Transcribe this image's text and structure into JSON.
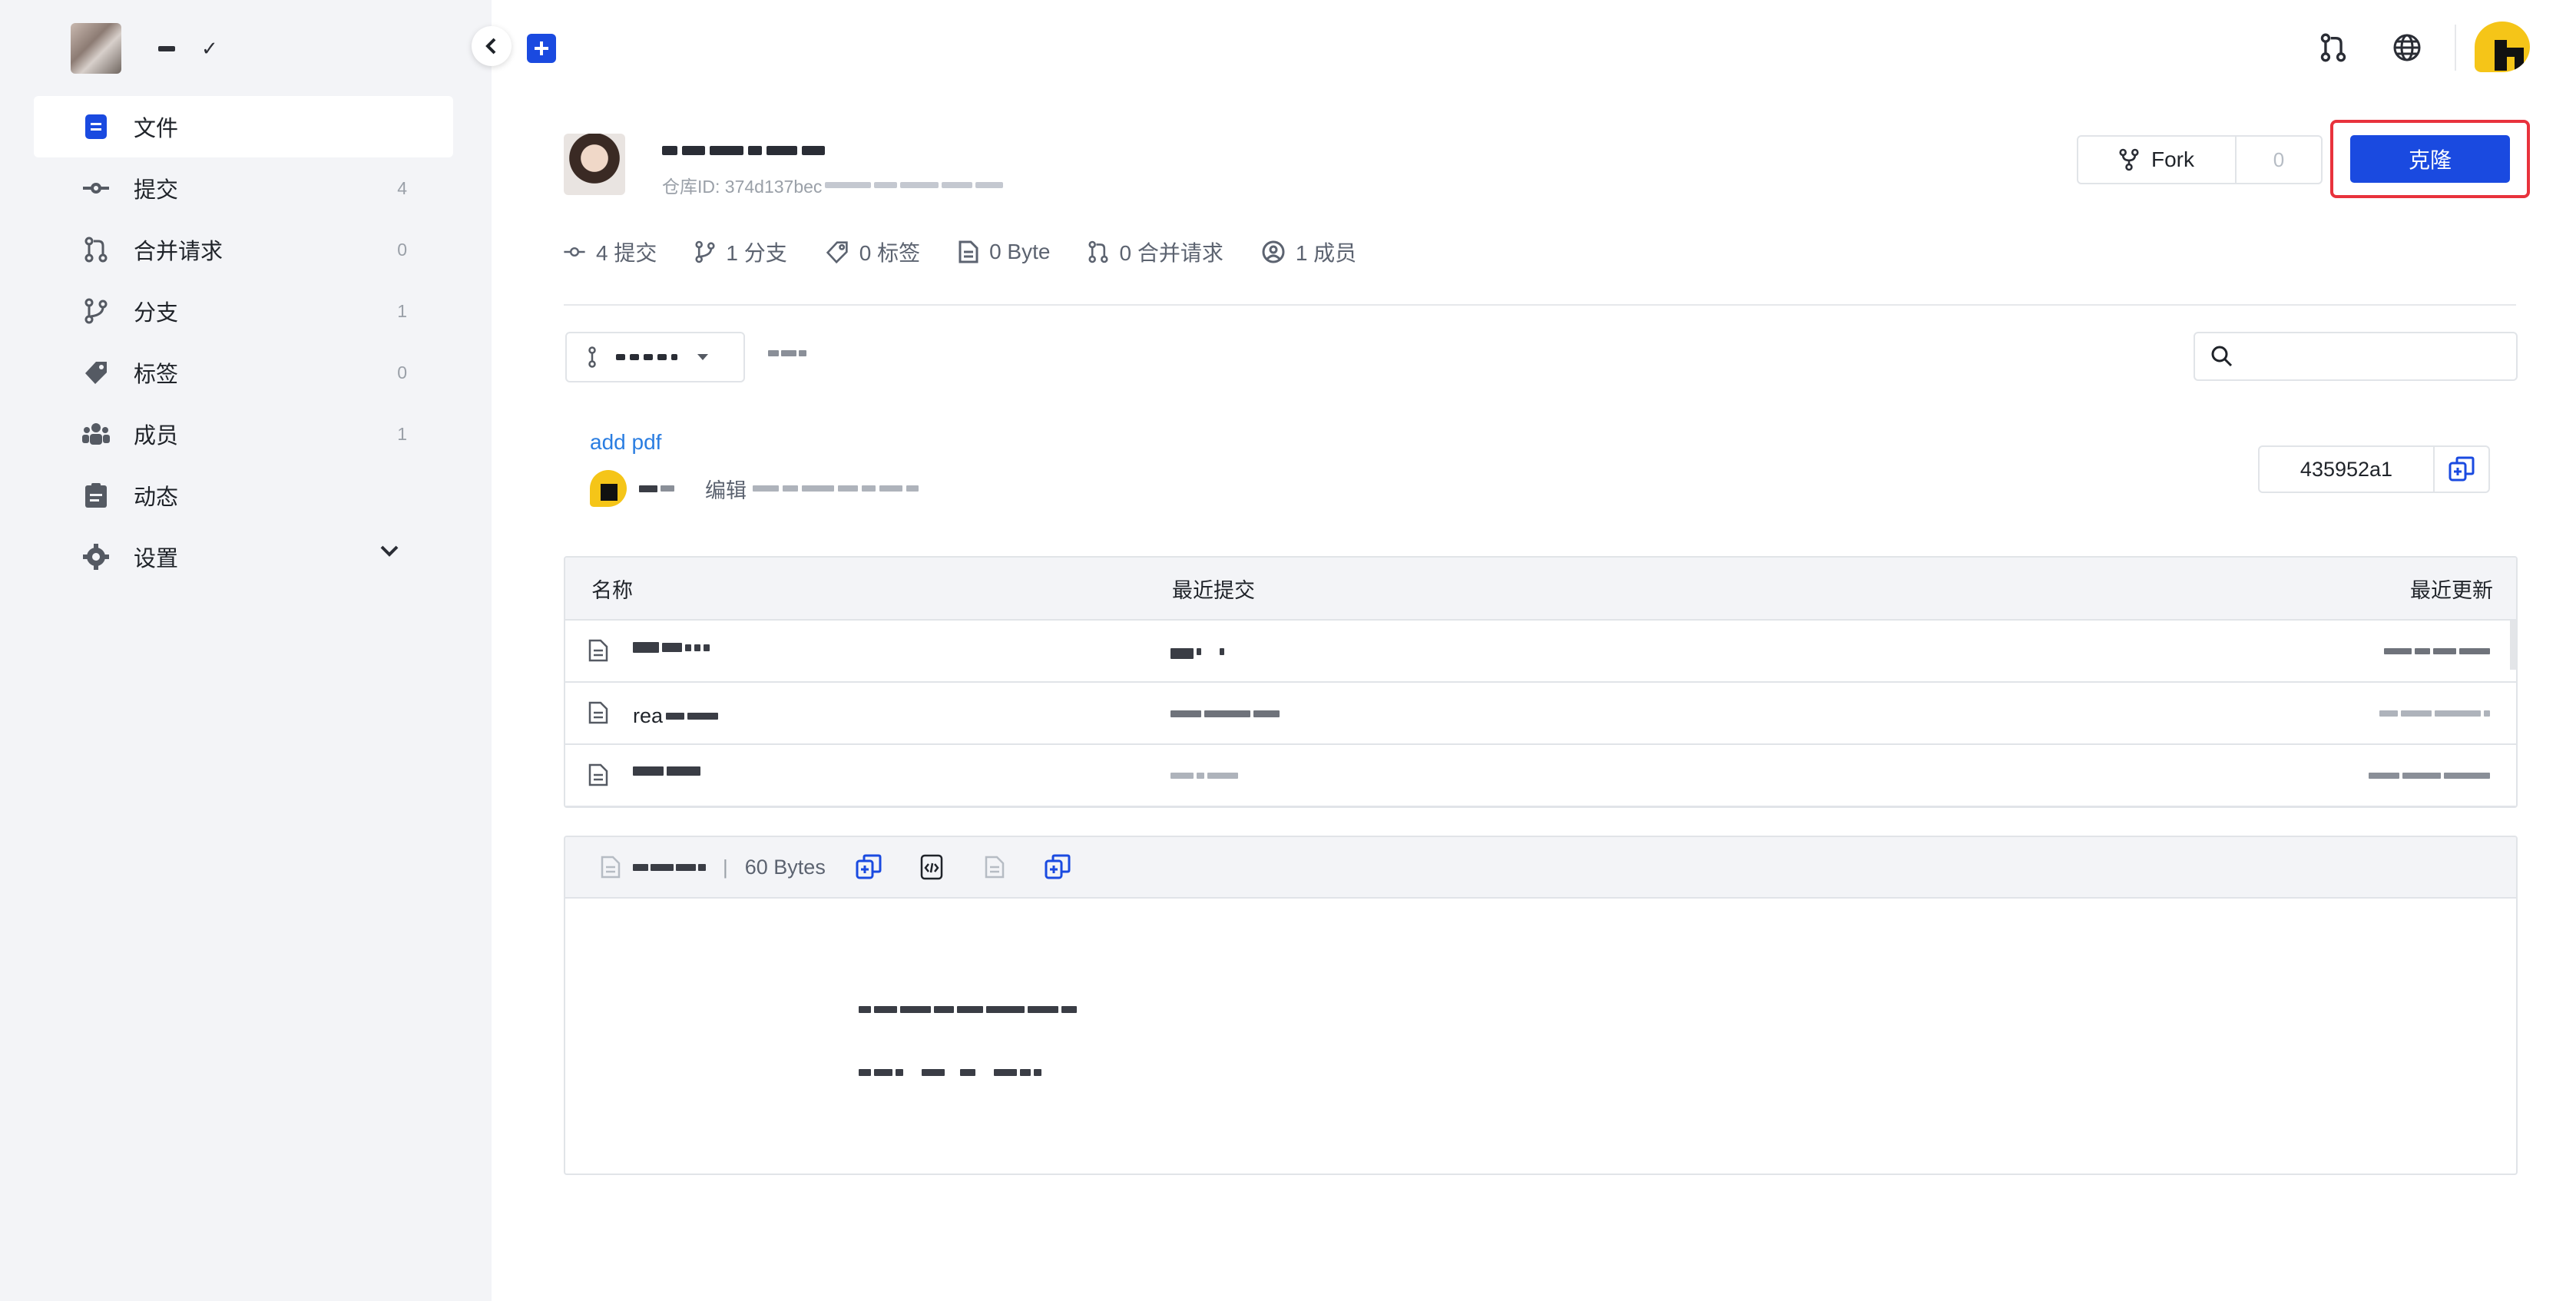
{
  "sidebar": {
    "items": [
      {
        "label": "文件",
        "count": "",
        "icon": "file-icon",
        "active": true
      },
      {
        "label": "提交",
        "count": "4",
        "icon": "commit-icon"
      },
      {
        "label": "合并请求",
        "count": "0",
        "icon": "merge-request-icon"
      },
      {
        "label": "分支",
        "count": "1",
        "icon": "branch-icon"
      },
      {
        "label": "标签",
        "count": "0",
        "icon": "tag-icon"
      },
      {
        "label": "成员",
        "count": "1",
        "icon": "members-icon"
      },
      {
        "label": "动态",
        "count": "",
        "icon": "activity-icon"
      },
      {
        "label": "设置",
        "count": "",
        "icon": "settings-icon"
      }
    ]
  },
  "repo": {
    "id_label": "仓库ID: 374d137bec",
    "fork_label": "Fork",
    "fork_count": "0",
    "clone_label": "克隆"
  },
  "stats": [
    {
      "label": "4 提交",
      "icon": "commit-icon"
    },
    {
      "label": "1 分支",
      "icon": "branch-icon"
    },
    {
      "label": "0 标签",
      "icon": "tag-icon"
    },
    {
      "label": "0 Byte",
      "icon": "document-icon"
    },
    {
      "label": "0 合并请求",
      "icon": "merge-request-icon"
    },
    {
      "label": "1 成员",
      "icon": "user-icon"
    }
  ],
  "commit": {
    "message": "add pdf",
    "edit_label": "编辑",
    "hash": "435952a1"
  },
  "table": {
    "headers": {
      "name": "名称",
      "last_commit": "最近提交",
      "last_update": "最近更新"
    },
    "rows": [
      {
        "name_prefix": ""
      },
      {
        "name_prefix": "rea"
      },
      {
        "name_prefix": ""
      }
    ]
  },
  "readme": {
    "separator": "|",
    "size": "60 Bytes"
  },
  "colors": {
    "primary": "#1a4ae0",
    "highlight_frame": "#e8323c",
    "link": "#2a7de1",
    "sidebar_bg": "#f3f4f7"
  }
}
